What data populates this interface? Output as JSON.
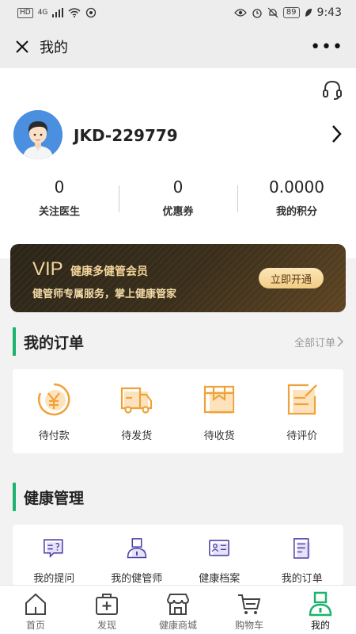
{
  "status_bar": {
    "hd": "HD",
    "network": "4G",
    "battery": "89",
    "time": "9:43"
  },
  "title_bar": {
    "title": "我的",
    "more": "•••"
  },
  "profile": {
    "username": "JKD-229779",
    "stats": [
      {
        "value": "0",
        "label": "关注医生"
      },
      {
        "value": "0",
        "label": "优惠券"
      },
      {
        "value": "0.0000",
        "label": "我的积分"
      }
    ]
  },
  "vip": {
    "tag": "VIP",
    "title": "健康多健管会员",
    "desc": "健管师专属服务，掌上健康管家",
    "button": "立即开通"
  },
  "orders": {
    "title": "我的订单",
    "all_label": "全部订单",
    "items": [
      {
        "label": "待付款",
        "icon": "yen-coin-icon"
      },
      {
        "label": "待发货",
        "icon": "truck-icon"
      },
      {
        "label": "待收货",
        "icon": "package-icon"
      },
      {
        "label": "待评价",
        "icon": "edit-note-icon"
      }
    ]
  },
  "health": {
    "title": "健康管理",
    "items": [
      {
        "label": "我的提问",
        "icon": "question-chat-icon"
      },
      {
        "label": "我的健管师",
        "icon": "health-manager-icon"
      },
      {
        "label": "健康档案",
        "icon": "id-card-icon"
      },
      {
        "label": "我的订单",
        "icon": "document-icon"
      }
    ]
  },
  "tab_bar": {
    "items": [
      {
        "label": "首页",
        "icon": "home-icon"
      },
      {
        "label": "发现",
        "icon": "medical-kit-icon"
      },
      {
        "label": "健康商城",
        "icon": "store-icon"
      },
      {
        "label": "购物车",
        "icon": "cart-icon"
      },
      {
        "label": "我的",
        "icon": "person-icon"
      }
    ],
    "active": "我的"
  },
  "colors": {
    "accent": "#19b36b",
    "icon_orange": "#f0a23a",
    "icon_purple": "#4b3fa6",
    "vip_gold": "#f4d59a"
  }
}
